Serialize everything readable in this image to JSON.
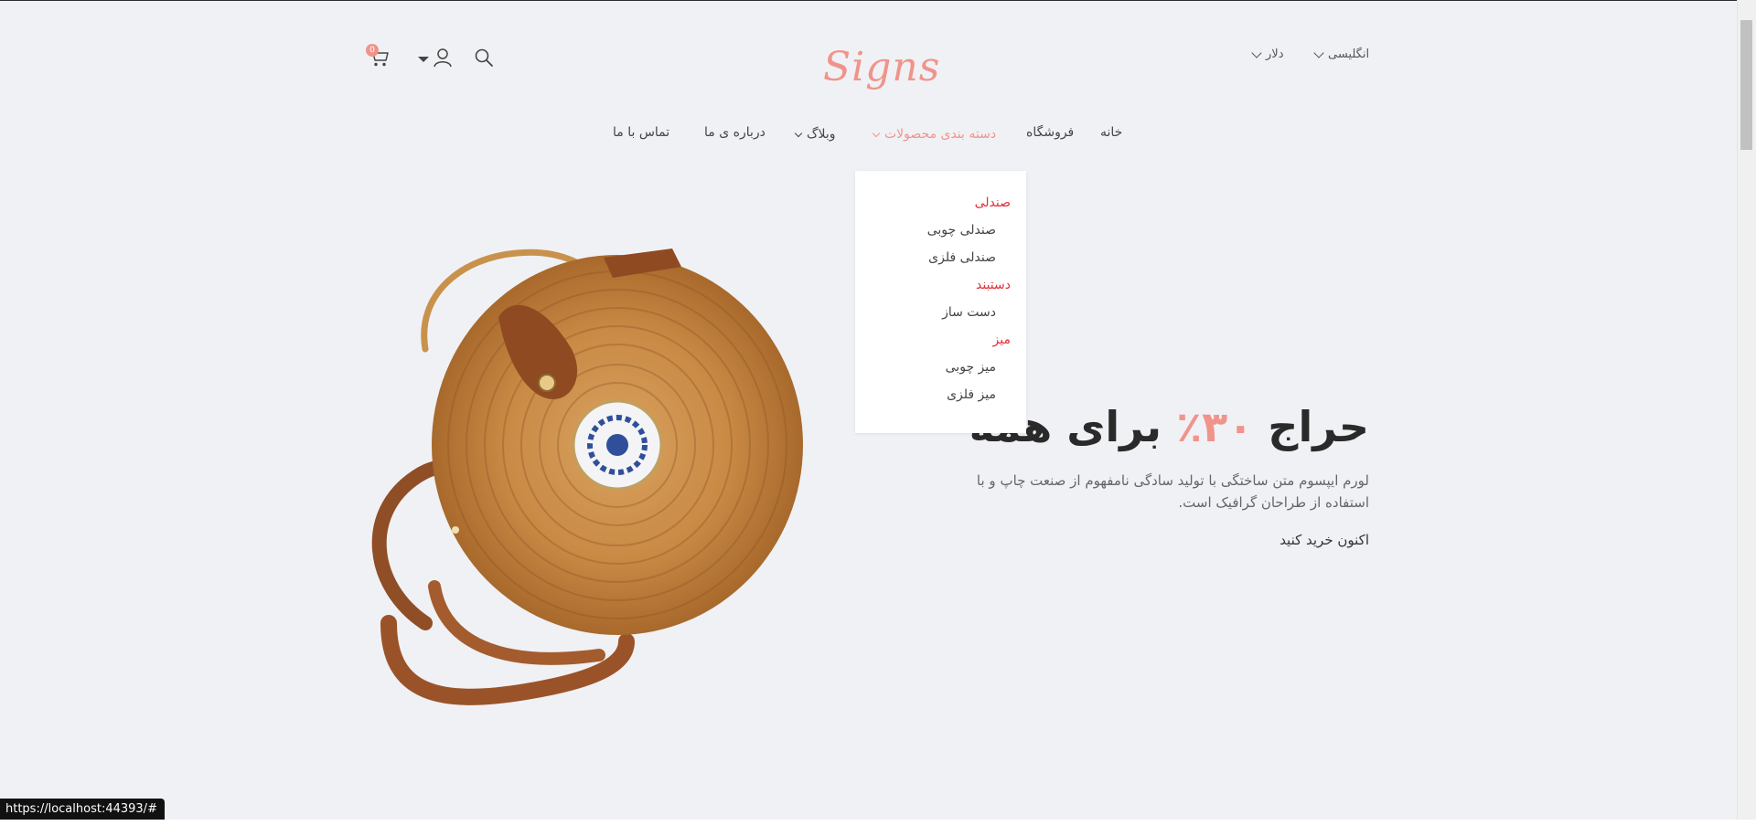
{
  "header": {
    "logo": "Signs",
    "language": "انگلیسی",
    "currency": "دلار",
    "cart_count": "0"
  },
  "nav": {
    "home": "خانه",
    "shop": "فروشگاه",
    "categories": "دسته بندی محصولات",
    "blog": "وبلاگ",
    "about": "درباره ی ما",
    "contact": "تماس با ما"
  },
  "dropdown": {
    "groups": [
      {
        "title": "صندلی",
        "items": [
          "صندلی چوبی",
          "صندلی فلزی"
        ]
      },
      {
        "title": "دستبند",
        "items": [
          "دست ساز"
        ]
      },
      {
        "title": "میز",
        "items": [
          "میز چوبی",
          "میز فلزی"
        ]
      }
    ]
  },
  "hero": {
    "title_pre": "حراج ",
    "title_pct": "۳۰٪",
    "title_post": " برای همه",
    "description": "لورم ایپسوم متن ساختگی با تولید سادگی نامفهوم از صنعت چاپ و با استفاده از طراحان گرافیک است.",
    "cta": "اکنون خرید کنید"
  },
  "status_url": "https://localhost:44393/#",
  "colors": {
    "accent": "#f0948b",
    "dropdown_heading": "#e0303a",
    "background": "#f0f1f5"
  }
}
